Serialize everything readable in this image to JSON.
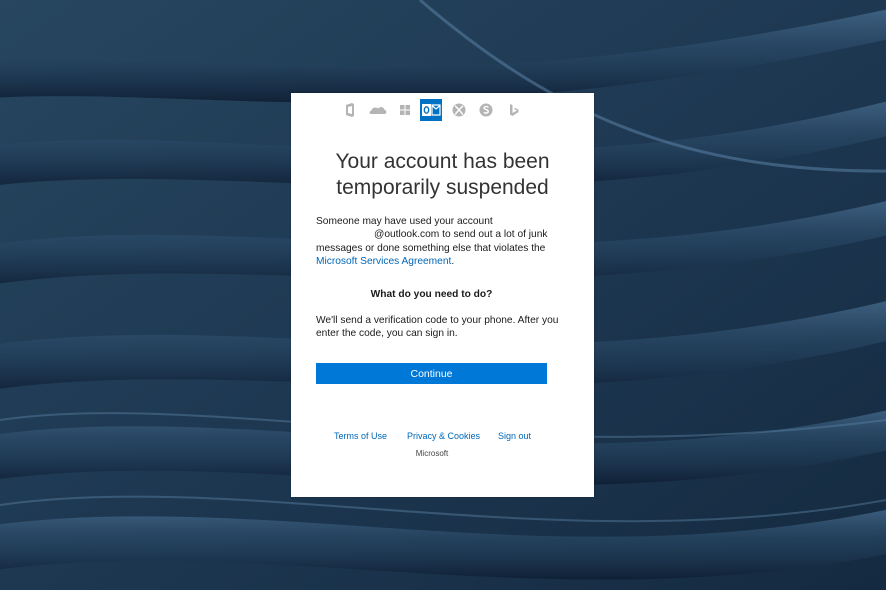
{
  "background": {
    "colors": {
      "base": "#1f3a55",
      "highlight": "#3e6284",
      "shadow": "#10223a"
    }
  },
  "product_bar": {
    "icons": [
      "office-icon",
      "onedrive-icon",
      "windows-icon",
      "outlook-icon",
      "xbox-icon",
      "skype-icon",
      "bing-icon"
    ],
    "active": "outlook-icon",
    "colors": {
      "inactive": "#b4b4b4",
      "active": "#0072c6"
    }
  },
  "card": {
    "title": "Your account has been temporarily suspended",
    "message": {
      "line1": "Someone may have used your account",
      "domain": "@outlook.com",
      "line2": "to send out a lot of junk messages or done something else that violates the",
      "agreement_link": "Microsoft Services Agreement",
      "end": "."
    },
    "heading": "What do you need to do?",
    "instructions": "We'll send a verification code to your phone.  After you enter the code, you can sign in.",
    "continue_label": "Continue"
  },
  "footer": {
    "terms": "Terms of Use",
    "privacy": "Privacy & Cookies",
    "signout": "Sign out",
    "brand": "Microsoft"
  },
  "colors": {
    "link": "#0067b8",
    "button": "#0078d7",
    "text": "#1b1b1b",
    "title": "#333333"
  }
}
